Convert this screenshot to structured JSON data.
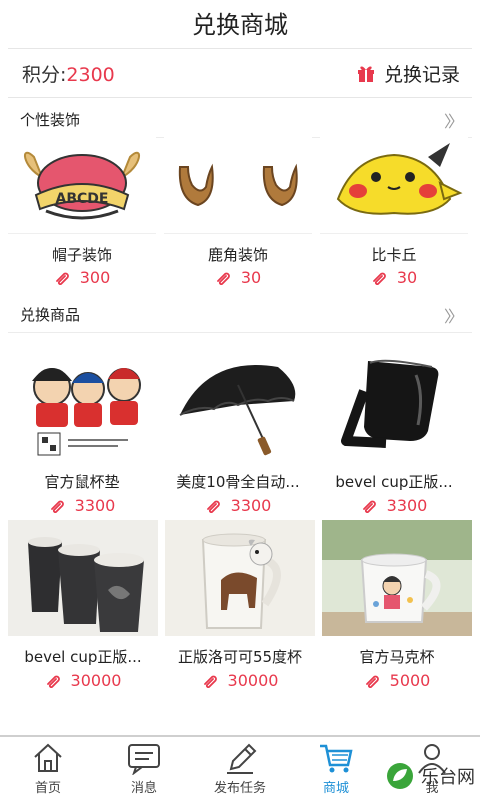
{
  "header": {
    "title": "兑换商城"
  },
  "points": {
    "label": "积分:",
    "value": "2300"
  },
  "history": {
    "label": "兑换记录",
    "icon": "gift-icon"
  },
  "decorations": {
    "title": "个性装饰",
    "items": [
      {
        "name": "帽子装饰",
        "price": "300",
        "hat_text": "ABCDE"
      },
      {
        "name": "鹿角装饰",
        "price": "30"
      },
      {
        "name": "比卡丘",
        "price": "30"
      }
    ]
  },
  "goods": {
    "title": "兑换商品",
    "items": [
      {
        "name": "官方鼠杯垫",
        "price": "3300"
      },
      {
        "name": "美度10骨全自动...",
        "price": "3300"
      },
      {
        "name": "bevel cup正版...",
        "price": "3300"
      },
      {
        "name": "bevel cup正版...",
        "price": "30000"
      },
      {
        "name": "正版洛可可55度杯",
        "price": "30000"
      },
      {
        "name": "官方马克杯",
        "price": "5000"
      }
    ]
  },
  "tabbar": {
    "tabs": [
      {
        "label": "首页",
        "icon": "home-icon"
      },
      {
        "label": "消息",
        "icon": "message-icon"
      },
      {
        "label": "发布任务",
        "icon": "pencil-icon"
      },
      {
        "label": "商城",
        "icon": "cart-icon",
        "active": true
      },
      {
        "label": "我",
        "icon": "user-icon"
      }
    ]
  },
  "watermark": {
    "text": "乐台网"
  },
  "colors": {
    "accent": "#e8394d",
    "active_tab": "#1e90d6"
  }
}
